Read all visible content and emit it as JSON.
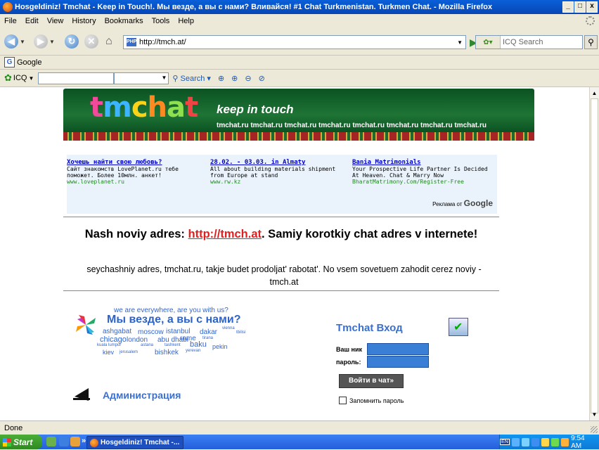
{
  "window": {
    "title": "Hosgeldiniz! Tmchat - Keep in Touch!. Мы везде, а вы с нами? Вливайся! #1 Chat Turkmenistan. Turkmen Chat. - Mozilla Firefox",
    "min": "_",
    "max": "□",
    "close": "x"
  },
  "menu": [
    "File",
    "Edit",
    "View",
    "History",
    "Bookmarks",
    "Tools",
    "Help"
  ],
  "nav": {
    "url": "http://tmch.at/",
    "search_placeholder": "ICQ Search"
  },
  "google_toolbar": {
    "label": "Google"
  },
  "icq_toolbar": {
    "label": "ICQ",
    "search_label": "Search",
    "buttons": [
      "⊕",
      "⊕",
      "⊖",
      "⊘"
    ]
  },
  "page": {
    "logo": [
      "t",
      "m",
      "c",
      "h",
      "a",
      "t"
    ],
    "slogan": "keep in touch",
    "domains": "tmchat.ru   tmchat.ru   tmchat.ru   tmchat.ru   tmchat.ru   tmchat.ru   tmchat.ru   tmchat.ru",
    "ads": [
      {
        "title": "Хочешь найти свою любовь?",
        "body": "Сайт знакомств LovePlanet.ru тебе поможет. Более 10млн. анкет!",
        "url": "www.loveplanet.ru"
      },
      {
        "title": "28.02. - 03.03. in Almaty",
        "body": "All about building materials shipment from Europe at stand",
        "url": "www.rw.kz"
      },
      {
        "title": "Bania Matrimonials",
        "body": "Your Prospective Life Partner Is Decided At Heaven. Chat & Marry Now",
        "url": "BharatMatrimony.Com/Register-Free"
      }
    ],
    "ads_by": "Реклама от",
    "ads_google": "Google",
    "headline_pre": "Nash noviy adres: ",
    "headline_link": "http://tmch.at",
    "headline_post": ". Samiy korotkiy chat adres v internete!",
    "subtext": "seychashniy adres, tmchat.ru, takje budet prodoljat' rabotat'. No vsem sovetuem zahodit cerez noviy - tmch.at",
    "cloud_top": "we are everywhere, are you with us?",
    "cloud_big": "Мы везде, а вы с нами?",
    "cloud_cities": [
      "ashgabat",
      "moscow",
      "istanbul",
      "dakar",
      "vienna",
      "chicago",
      "rome",
      "tirana",
      "london",
      "abu dhabi",
      "baku",
      "kuala lumpur",
      "astana",
      "tashkent",
      "pekin",
      "kiev",
      "jerusalem",
      "bishkek",
      "yerevan",
      "tbilisi"
    ],
    "admin": "Администрация",
    "login": {
      "title": "Tmchat Вход",
      "nick_label": "Ваш ник",
      "pass_label": "пароль:",
      "submit": "Войти в чат»",
      "remember": "Запомнить пароль"
    }
  },
  "status": "Done",
  "taskbar": {
    "start": "Start",
    "more": "»",
    "task": "Hosgeldiniz! Tmchat -...",
    "lang": "EN",
    "time": "9:54 AM"
  },
  "colors": {
    "banner_green": "#1e7435",
    "link_red": "#e02020",
    "accent_blue": "#3a6fd0"
  }
}
